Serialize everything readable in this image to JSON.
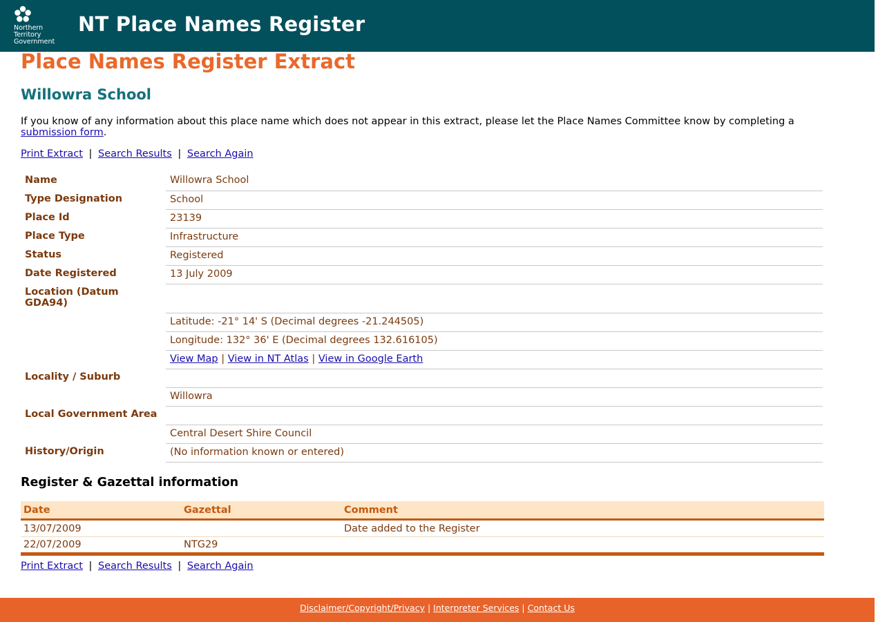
{
  "header": {
    "logo_lines": [
      "Northern",
      "Territory",
      "Government"
    ],
    "site_title": "NT Place Names Register"
  },
  "page_title": "Place Names Register Extract",
  "place_title": "Willowra School",
  "intro": {
    "text": "If you know of any information about this place name which does not appear in this extract, please let the Place Names Committee know by completing a ",
    "link": "submission form",
    "end": "."
  },
  "nav_links": {
    "print": "Print Extract",
    "results": "Search Results",
    "again": "Search Again",
    "sep": "|"
  },
  "details": {
    "name_label": "Name",
    "name_value": "Willowra School",
    "type_label": "Type Designation",
    "type_value": "School",
    "id_label": "Place Id",
    "id_value": "23139",
    "ptype_label": "Place Type",
    "ptype_value": "Infrastructure",
    "status_label": "Status",
    "status_value": "Registered",
    "date_label": "Date Registered",
    "date_value": "13 July 2009",
    "location_label": "Location (Datum GDA94)",
    "latitude": "Latitude: -21° 14' S (Decimal degrees -21.244505)",
    "longitude": "Longitude: 132° 36' E (Decimal degrees 132.616105)",
    "map_link": "View Map",
    "atlas_link": "View in NT Atlas",
    "earth_link": "View in Google Earth",
    "locality_label": "Locality / Suburb",
    "locality_value": "Willowra",
    "lga_label": "Local Government Area",
    "lga_value": "Central Desert Shire Council",
    "history_label": "History/Origin",
    "history_value": "(No information known or entered)"
  },
  "register": {
    "title": "Register & Gazettal information",
    "headers": [
      "Date",
      "Gazettal",
      "Comment"
    ],
    "rows": [
      [
        "13/07/2009",
        "",
        "Date added to the Register"
      ],
      [
        "22/07/2009",
        "NTG29",
        ""
      ]
    ]
  },
  "footer": {
    "disclaimer": "Disclaimer/Copyright/Privacy",
    "interpreter": "Interpreter Services",
    "contact": "Contact Us",
    "sep": "|"
  },
  "colors": {
    "header_bg": "#02505c",
    "title_orange": "#e8692a",
    "place_teal": "#13717a",
    "footer_bg": "#e8632a"
  }
}
